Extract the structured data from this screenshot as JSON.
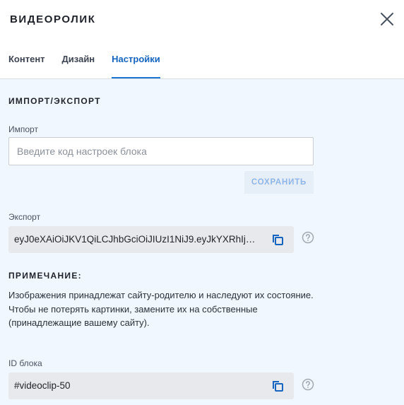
{
  "header": {
    "title": "ВИДЕОРОЛИК",
    "tabs": [
      {
        "label": "Контент"
      },
      {
        "label": "Дизайн"
      },
      {
        "label": "Настройки"
      }
    ],
    "active_tab": "Настройки"
  },
  "settings": {
    "import_export_heading": "ИМПОРТ/ЭКСПОРТ",
    "import_label": "Импорт",
    "import_placeholder": "Введите код настроек блока",
    "import_value": "",
    "save_label": "СОХРАНИТЬ",
    "export_label": "Экспорт",
    "export_value": "eyJ0eXAiOiJKV1QiLCJhbGciOiJIUzI1NiJ9.eyJkYXRhIjoie...",
    "note_heading": "ПРИМЕЧАНИЕ:",
    "note_text": "Изображения принадлежат сайту-родителю и наследуют их состояние. Чтобы не потерять картинки, замените их на собственные (принадлежащие вашему сайту).",
    "block_id_label": "ID блока",
    "block_id_value": "#videoclip-50"
  },
  "icons": {
    "close": "close-icon",
    "copy": "copy-icon",
    "help": "help-circle-icon"
  },
  "colors": {
    "accent": "#1976d2",
    "panel_bg": "#f1f7fe",
    "field_bg": "#e8e9ec"
  }
}
